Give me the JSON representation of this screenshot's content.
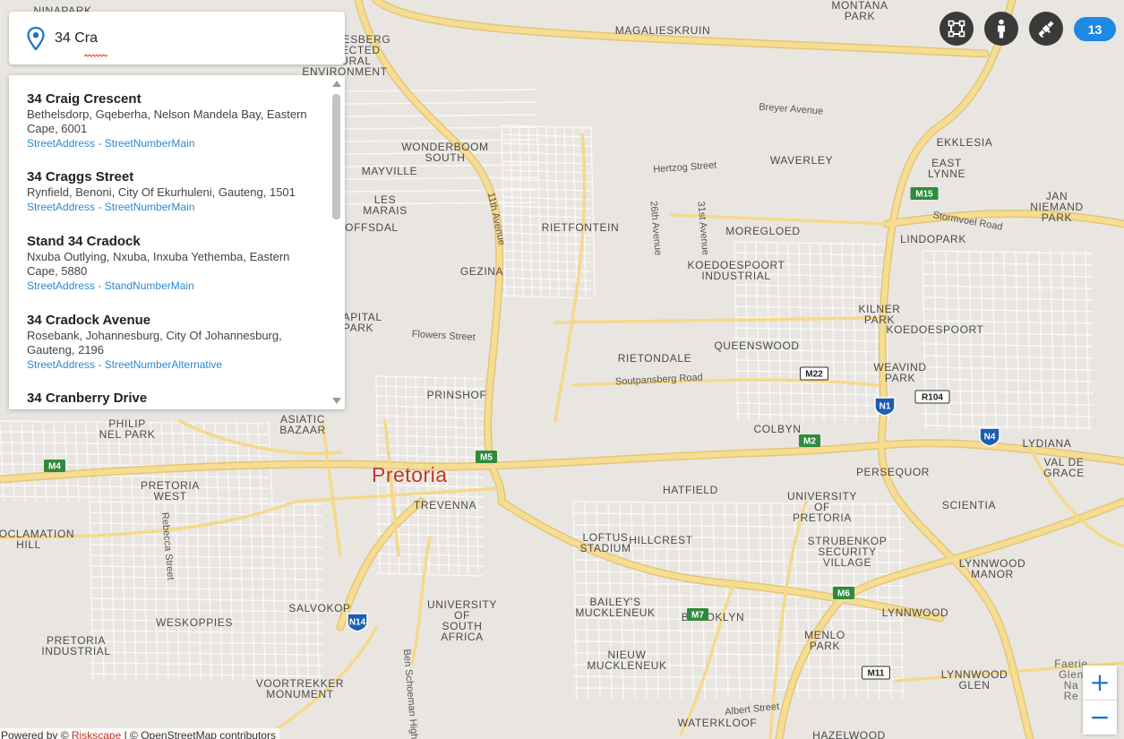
{
  "search": {
    "value": "34 Cra",
    "icon": "map-pin-icon"
  },
  "results": [
    {
      "name": "34 Craig Crescent",
      "address": "Bethelsdorp, Gqeberha, Nelson Mandela Bay, Eastern Cape, 6001",
      "type": "StreetAddress - StreetNumberMain"
    },
    {
      "name": "34 Craggs Street",
      "address": "Rynfield, Benoni, City Of Ekurhuleni, Gauteng, 1501",
      "type": "StreetAddress - StreetNumberMain"
    },
    {
      "name": "Stand 34 Cradock",
      "address": "Nxuba Outlying, Nxuba, Inxuba Yethemba, Eastern Cape, 5880",
      "type": "StreetAddress - StandNumberMain"
    },
    {
      "name": "34 Cradock Avenue",
      "address": "Rosebank, Johannesburg, City Of Johannesburg, Gauteng, 2196",
      "type": "StreetAddress - StreetNumberAlternative"
    },
    {
      "name": "34 Cranberry Drive",
      "address": "",
      "type": ""
    }
  ],
  "toolbar": {
    "buttons": [
      "polygon-select-icon",
      "person-icon",
      "satellite-icon"
    ],
    "zoom_level": "13"
  },
  "zoom_controls": {
    "zoom_in": "+",
    "zoom_out": "−"
  },
  "attribution": {
    "prefix": "Powered by ©",
    "brand": "Riskscape",
    "suffix": "| © OpenStreetMap contributors"
  },
  "colors": {
    "accent": "#1e88e5",
    "road": "#f5d98b",
    "city_label": "#c0392b",
    "link": "#2a8bd0"
  },
  "map": {
    "city": "Pretoria",
    "places": [
      "NINAPARK",
      "MONTANA PARK",
      "MAGALIESBERG PROTECTED NATURAL ENVIRONMENT",
      "MAGALIESKRUIN",
      "EKKLESIA",
      "WONDERBOOM SOUTH",
      "WAVERLEY",
      "EAST LYNNE",
      "MAYVILLE",
      "JAN NIEMAND PARK",
      "LES MARAIS",
      "ELOFFSDAL",
      "RIETFONTEIN",
      "MOREGLOED",
      "LINDOPARK",
      "GEZINA",
      "KOEDOESPOORT INDUSTRIAL",
      "KILNER PARK",
      "CAPITAL PARK",
      "KOEDOESPOORT",
      "QUEENSWOOD",
      "RIETONDALE",
      "WEAVIND PARK",
      "PRINSHOF",
      "ASIATIC BAZAAR",
      "PHILIP NEL PARK",
      "COLBYN",
      "LYDIANA",
      "VAL DE GRACE",
      "PRETORIA WEST",
      "PERSEQUOR",
      "HATFIELD",
      "UNIVERSITY OF PRETORIA",
      "SCIENTIA",
      "TREVENNA",
      "PROCLAMATION HILL",
      "LOFTUS STADIUM",
      "HILLCREST",
      "STRUBENKOP SECURITY VILLAGE",
      "LYNNWOOD MANOR",
      "SALVOKOP",
      "UNIVERSITY OF SOUTH AFRICA",
      "WESKOPPIES",
      "BAILEY'S MUCKLENEUK",
      "BROOKLYN",
      "LYNNWOOD",
      "MENLO PARK",
      "PRETORIA INDUSTRIAL",
      "NIEUW MUCKLENEUK",
      "LYNNWOOD GLEN",
      "VOORTREKKER MONUMENT",
      "WATERKLOOF",
      "HAZELWOOD",
      "Faerie Glen Nature Reserve"
    ],
    "streets": [
      "Breyer Avenue",
      "Hertzog Street",
      "11th Avenue",
      "26th Avenue",
      "31st Avenue",
      "Stormvoel Road",
      "Flowers Street",
      "Soutpansberg Road",
      "Rebecca Street",
      "Albert Street",
      "Ben Schoeman Highway"
    ],
    "routes": [
      "M15",
      "M4",
      "M5",
      "M2",
      "M22",
      "R104",
      "N1",
      "N4",
      "M6",
      "M7",
      "N14",
      "M11"
    ]
  }
}
